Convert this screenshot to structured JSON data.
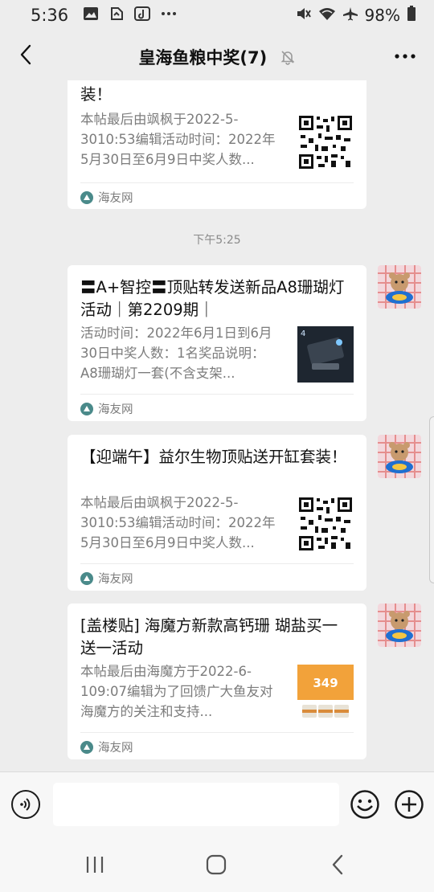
{
  "status_bar": {
    "time": "5:36",
    "battery": "98%",
    "left_icons": [
      "image-icon",
      "app-icon",
      "tiktok-icon",
      "more-dots-icon"
    ],
    "right_icons": [
      "mute-icon",
      "wifi-icon",
      "airplane-icon",
      "battery-icon"
    ]
  },
  "header": {
    "title": "皇海鱼粮中奖(7)",
    "back_icon": "chevron-left-icon",
    "mute_icon": "bell-off-icon",
    "more_icon": "more-icon"
  },
  "chat": {
    "timestamp": "下午5:25",
    "messages": [
      {
        "title": "【迎端午】益尔生物顶贴送开缸套装！",
        "title_visible": "装！",
        "description": "本帖最后由飒枫于2022-5-3010:53编辑活动时间：2022年5月30日至6月9日中奖人数...",
        "source": "海友网",
        "thumb": "qr-code-image"
      },
      {
        "title": "〓A+智控〓顶贴转发送新品A8珊瑚灯活动｜第2209期｜",
        "description": "活动时间：2022年6月1日到6月30日中奖人数：1名奖品说明：A8珊瑚灯一套(不含支架...",
        "source": "海友网",
        "thumb": "product-image"
      },
      {
        "title": "【迎端午】益尔生物顶贴送开缸套装！",
        "description": "本帖最后由飒枫于2022-5-3010:53编辑活动时间：2022年5月30日至6月9日中奖人数...",
        "source": "海友网",
        "thumb": "qr-code-image"
      },
      {
        "title": "[盖楼贴] 海魔方新款高钙珊 瑚盐买一送一活动",
        "description": "本帖最后由海魔方于2022-6-109:07编辑为了回馈广大鱼友对海魔方的关注和支持...",
        "source": "海友网",
        "thumb": "promo-image",
        "thumb_text": "349"
      }
    ]
  },
  "input_bar": {
    "voice_icon": "voice-icon",
    "emoji_icon": "emoji-icon",
    "plus_icon": "plus-icon",
    "placeholder": ""
  },
  "nav_bar": {
    "icons": [
      "recents-icon",
      "home-icon",
      "back-icon"
    ]
  },
  "colors": {
    "background": "#ededed",
    "card": "#ffffff",
    "text_secondary": "#7c7c7c",
    "source_icon": "#4a8a8a",
    "promo_orange": "#f2a23a"
  }
}
